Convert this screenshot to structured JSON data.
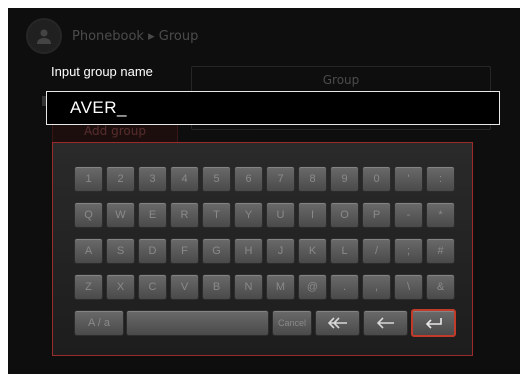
{
  "background": {
    "breadcrumb": "Phonebook ▸ Group",
    "group_panel_title": "Group",
    "add_group_label": "Add group"
  },
  "dialog": {
    "label": "Input group name",
    "value": "AVER_"
  },
  "keyboard": {
    "rows": [
      [
        "1",
        "2",
        "3",
        "4",
        "5",
        "6",
        "7",
        "8",
        "9",
        "0",
        "'",
        ":"
      ],
      [
        "Q",
        "W",
        "E",
        "R",
        "T",
        "Y",
        "U",
        "I",
        "O",
        "P",
        "-",
        "*"
      ],
      [
        "A",
        "S",
        "D",
        "F",
        "G",
        "H",
        "J",
        "K",
        "L",
        "/",
        ";",
        "#"
      ],
      [
        "Z",
        "X",
        "C",
        "V",
        "B",
        "N",
        "M",
        "@",
        ".",
        ",",
        "\\",
        "&"
      ]
    ],
    "shift_label": "A / a",
    "space_label": "",
    "cancel_label": "Cancel",
    "icons": {
      "clear": "double-left-arrow-icon",
      "backspace": "left-arrow-icon",
      "enter": "enter-return-icon"
    },
    "accent_color": "#c23a2a"
  }
}
